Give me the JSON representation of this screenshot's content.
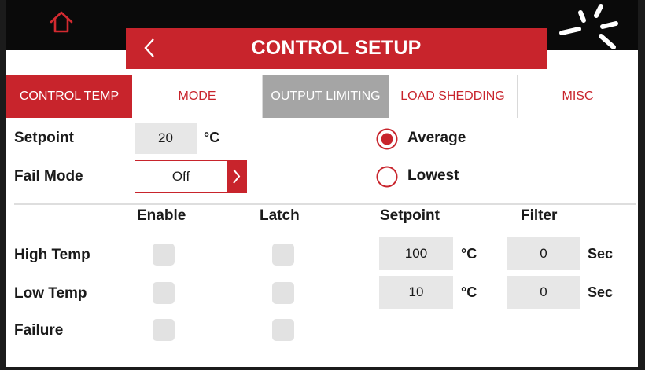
{
  "header": {
    "title": "CONTROL SETUP",
    "home_icon": "home-icon",
    "back_icon": "chevron-left-icon",
    "status_icon": "spinner-icon"
  },
  "tabs": [
    {
      "label": "CONTROL TEMP",
      "state": "active"
    },
    {
      "label": "MODE",
      "state": "normal"
    },
    {
      "label": "OUTPUT LIMITING",
      "state": "disabled"
    },
    {
      "label": "LOAD SHEDDING",
      "state": "normal"
    },
    {
      "label": "MISC",
      "state": "normal"
    }
  ],
  "setpoint": {
    "label": "Setpoint",
    "value": "20",
    "unit": "°C"
  },
  "fail_mode": {
    "label": "Fail Mode",
    "value": "Off"
  },
  "sensor_mode": {
    "options": [
      {
        "label": "Average",
        "selected": true
      },
      {
        "label": "Lowest",
        "selected": false
      }
    ]
  },
  "alarms": {
    "headers": {
      "enable": "Enable",
      "latch": "Latch",
      "setpoint": "Setpoint",
      "filter": "Filter"
    },
    "rows": [
      {
        "label": "High Temp",
        "enable": false,
        "latch": false,
        "setpoint": "100",
        "setpoint_unit": "°C",
        "filter": "0",
        "filter_unit": "Sec"
      },
      {
        "label": "Low Temp",
        "enable": false,
        "latch": false,
        "setpoint": "10",
        "setpoint_unit": "°C",
        "filter": "0",
        "filter_unit": "Sec"
      },
      {
        "label": "Failure",
        "enable": false,
        "latch": false
      }
    ]
  },
  "colors": {
    "accent": "#c8242c",
    "disabled": "#a5a5a5",
    "field": "#e7e7e7"
  }
}
